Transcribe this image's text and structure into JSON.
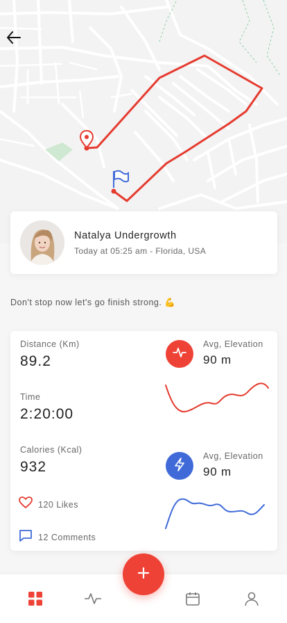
{
  "colors": {
    "accent_red": "#ee4236",
    "accent_blue": "#3f6ad8",
    "route": "#e53b2f"
  },
  "header": {
    "back_icon": "arrow-left-icon"
  },
  "profile": {
    "name": "Natalya Undergrowth",
    "meta": "Today at 05:25 am - Florida, USA"
  },
  "motto": "Don't stop now let's go finish strong. 💪",
  "stats": {
    "distance": {
      "label": "Distance (Km)",
      "value": "89.2"
    },
    "time": {
      "label": "Time",
      "value": "2:20:00"
    },
    "calories": {
      "label": "Calories (Kcal)",
      "value": "932"
    },
    "elevation_1": {
      "label": "Avg, Elevation",
      "value": "90 m",
      "icon": "heartbeat-icon"
    },
    "elevation_2": {
      "label": "Avg, Elevation",
      "value": "90 m",
      "icon": "lightning-icon"
    }
  },
  "social": {
    "likes": "120 Likes",
    "comments": "12 Comments"
  },
  "nav": {
    "items": [
      "dashboard-icon",
      "activity-icon",
      "calendar-icon",
      "profile-icon"
    ],
    "active": "dashboard-icon",
    "fab_icon": "plus-icon"
  }
}
